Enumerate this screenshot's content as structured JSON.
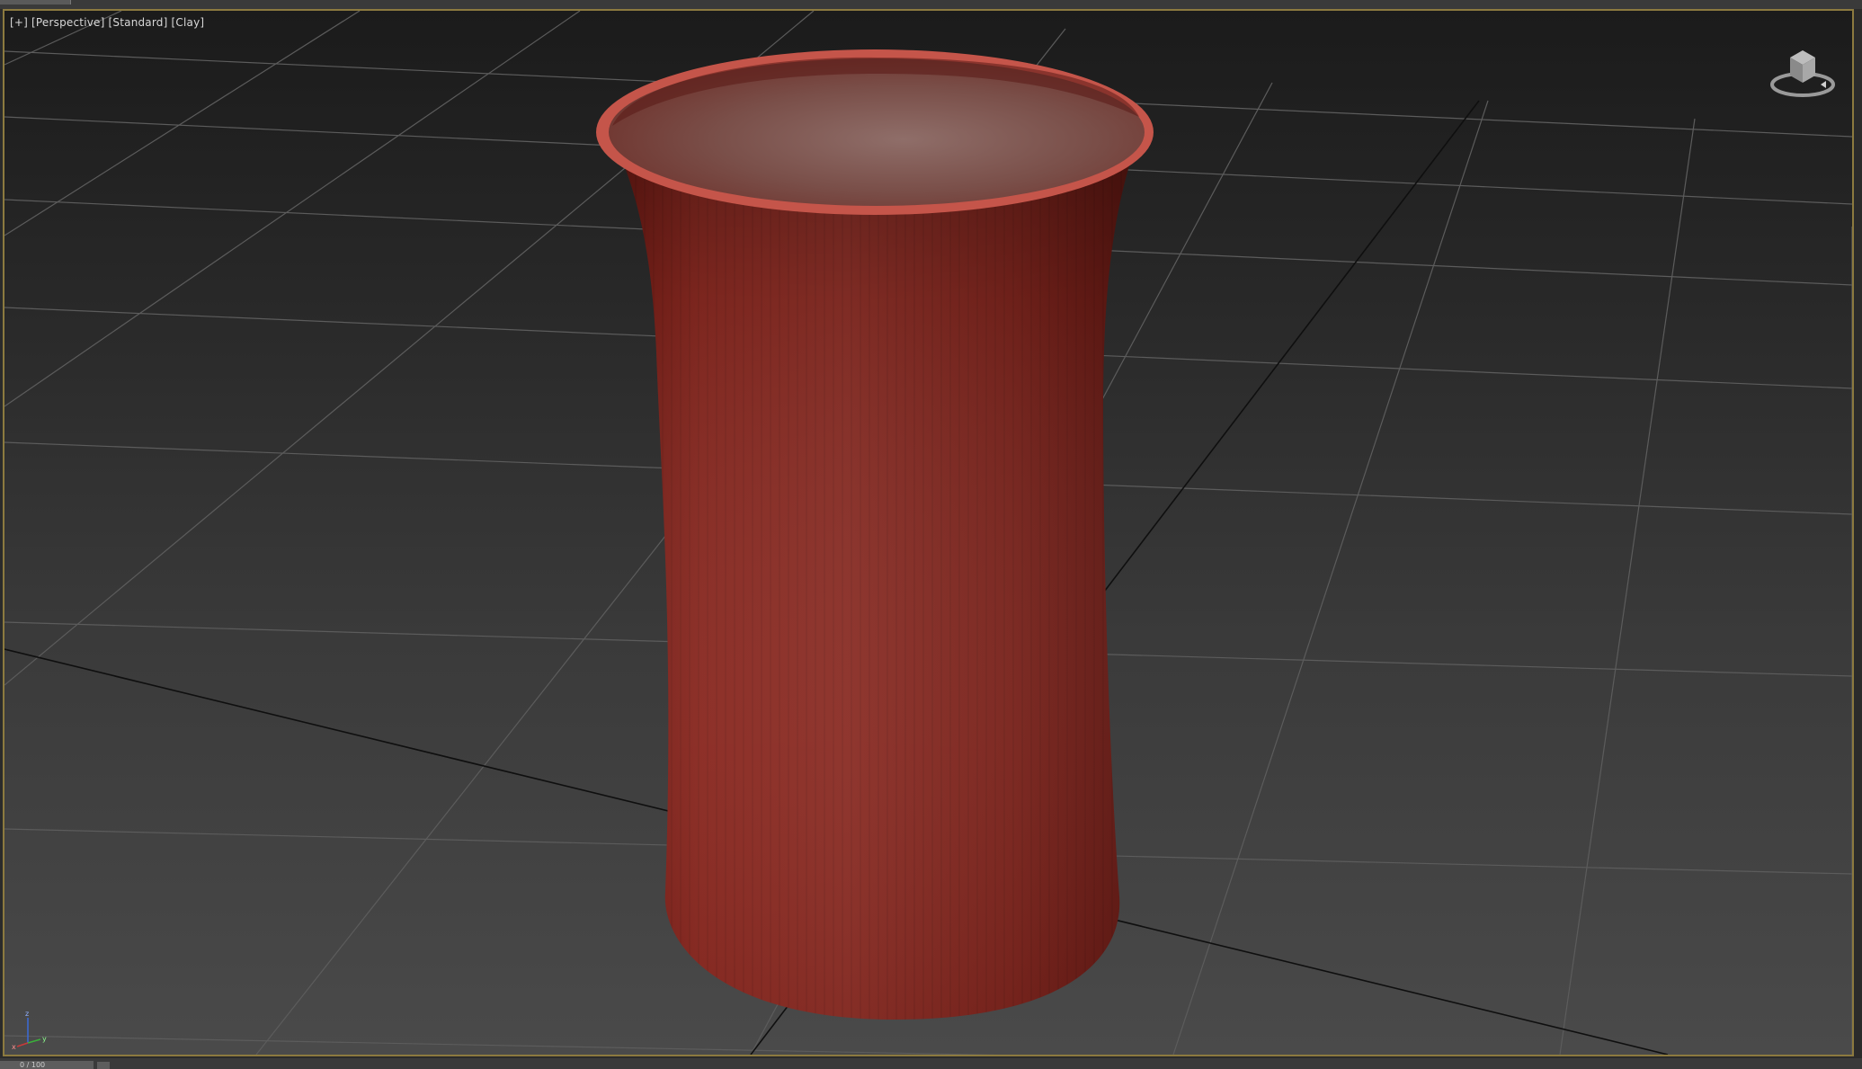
{
  "viewport": {
    "label_parts": [
      "[+]",
      "[Perspective]",
      "[Standard]",
      "[Clay]"
    ]
  },
  "object": {
    "name": "red-vase",
    "color": "#8a2a22",
    "rim_color": "#c5554a"
  },
  "colors": {
    "viewport_border": "#8c7a3f",
    "grid_line": "#5c5c5c",
    "world_axis_line": "#0f0f0f"
  },
  "icons": {
    "viewcube": "viewcube-icon",
    "axis_gizmo": "axis-tripod-icon"
  },
  "axis_gizmo": {
    "labels": [
      "x",
      "y",
      "z"
    ]
  },
  "status": {
    "frame_tab": "0 / 100"
  }
}
